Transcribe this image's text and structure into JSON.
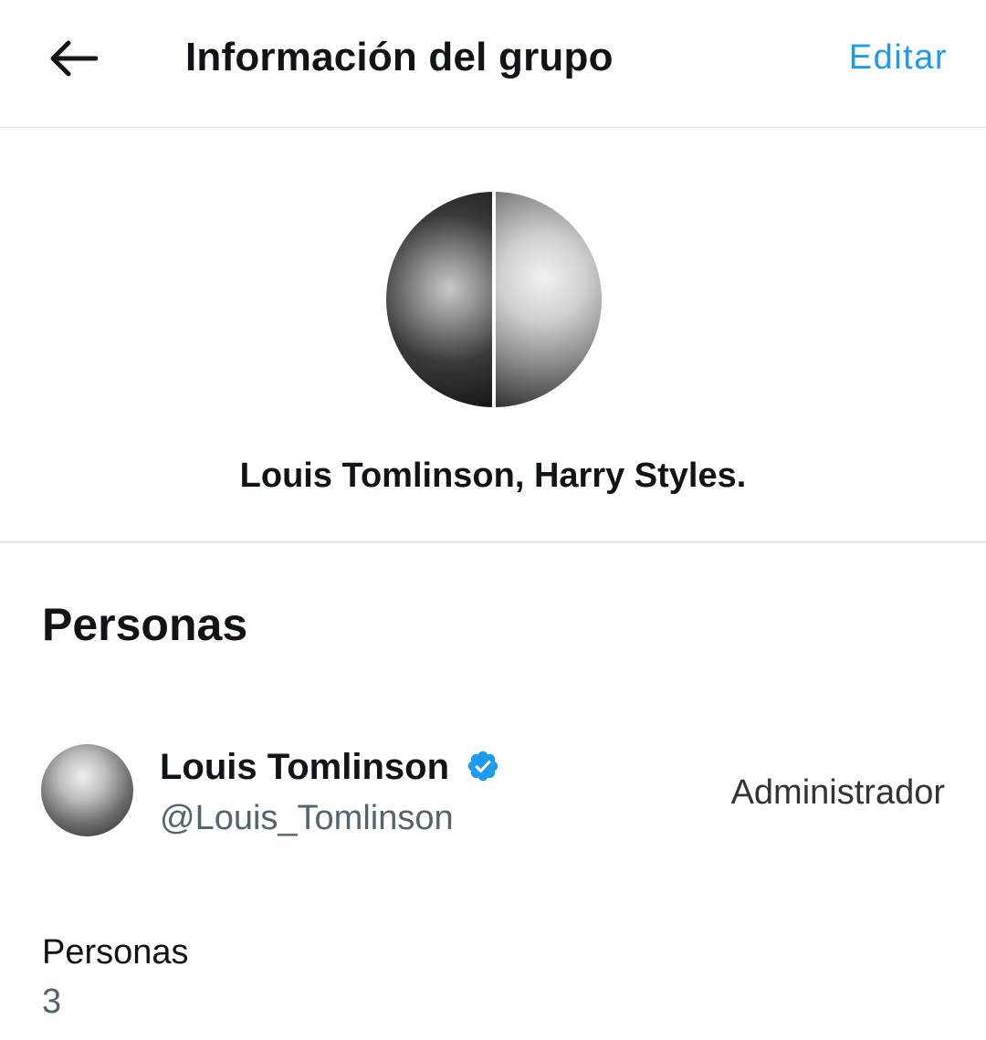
{
  "header": {
    "title": "Información del grupo",
    "edit_label": "Editar",
    "back_icon": "arrow-left-icon"
  },
  "group": {
    "name": "Louis Tomlinson, Harry Styles."
  },
  "people_section": {
    "heading": "Personas",
    "members": [
      {
        "name": "Louis Tomlinson",
        "handle": "@Louis_Tomlinson",
        "role": "Administrador",
        "verified": true,
        "badge_icon": "verified-badge-icon"
      }
    ]
  },
  "people_count": {
    "label": "Personas",
    "value": "3"
  },
  "colors": {
    "accent": "#1d9bf0",
    "text_primary": "#0f1419",
    "text_secondary": "#536471",
    "divider": "#e1e4e8"
  }
}
